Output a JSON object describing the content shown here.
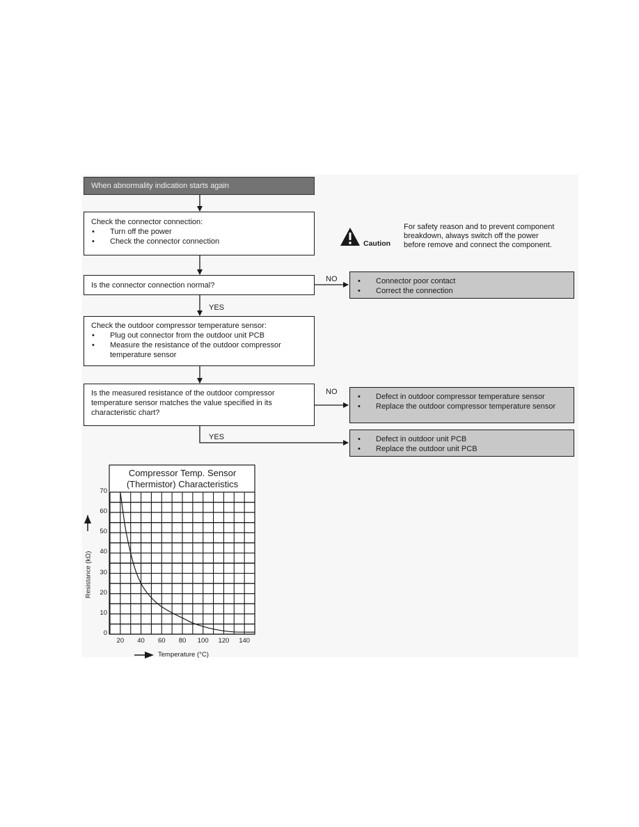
{
  "flowchart": {
    "start": "When abnormality indication starts again",
    "step1": {
      "title": "Check the connector connection:",
      "items": [
        "Turn off the power",
        "Check the connector connection"
      ]
    },
    "decision1": "Is the connector connection normal?",
    "decision1_no": [
      "Connector poor contact",
      "Correct the connection"
    ],
    "step2": {
      "title": "Check the outdoor compressor temperature sensor:",
      "items": [
        "Plug out connector from the outdoor unit PCB",
        "Measure the resistance of the outdoor compressor temperature sensor"
      ]
    },
    "decision2": "Is the measured resistance of the outdoor compressor temperature sensor matches the value specified in its characteristic chart?",
    "decision2_no": [
      "Defect in outdoor compressor temperature sensor",
      "Replace the outdoor compressor temperature sensor"
    ],
    "decision2_yes": [
      "Defect in outdoor unit PCB",
      "Replace the outdoor unit PCB"
    ],
    "no_label": "NO",
    "yes_label": "YES",
    "bullet": "•"
  },
  "caution": {
    "icon": "warning-triangle-icon",
    "label": "Caution",
    "text_lines": [
      "For safety reason and to prevent component",
      "breakdown, always switch off the power",
      "before remove and connect the component."
    ]
  },
  "chart_data": {
    "type": "line",
    "title_lines": [
      "Compressor Temp. Sensor",
      "(Thermistor) Characteristics"
    ],
    "xlabel": "Temperature (°C)",
    "ylabel": "Resistance (kΩ)",
    "xlim": [
      10,
      150
    ],
    "ylim": [
      0,
      70
    ],
    "xticks": [
      20,
      40,
      60,
      80,
      100,
      120,
      140
    ],
    "yticks": [
      0,
      10,
      20,
      30,
      40,
      50,
      60,
      70
    ],
    "grid": true,
    "x_grid_step": 10,
    "y_grid_step": 5,
    "legend": "none",
    "series": [
      {
        "name": "Resistance",
        "x": [
          20,
          25,
          30,
          35,
          40,
          45,
          50,
          55,
          60,
          70,
          80,
          90,
          100,
          110,
          120,
          130,
          140,
          150
        ],
        "y": [
          70,
          52,
          40,
          31,
          25,
          21,
          18,
          15.5,
          13.5,
          10.5,
          8,
          5.5,
          3.8,
          2.5,
          1.6,
          1.1,
          1,
          1
        ]
      }
    ]
  }
}
